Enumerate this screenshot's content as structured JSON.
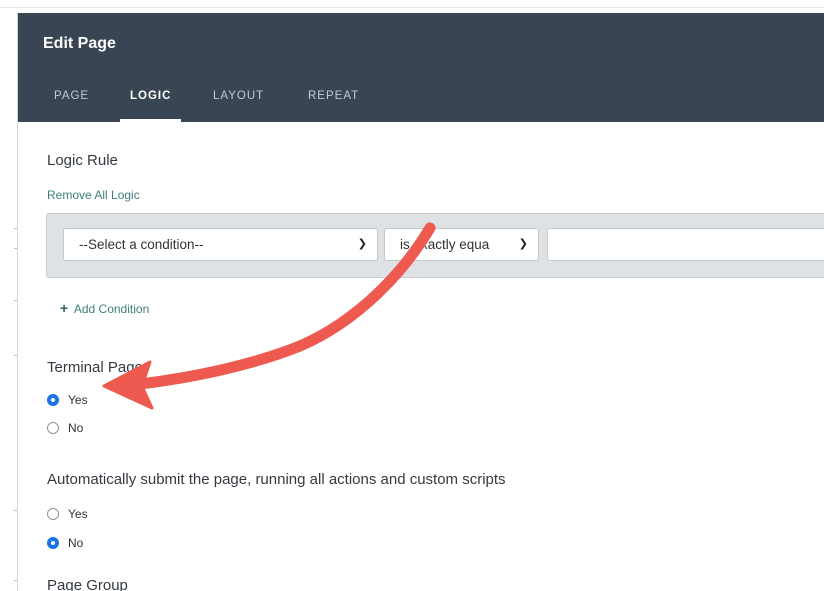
{
  "header": {
    "title": "Edit Page",
    "tabs": [
      {
        "label": "PAGE",
        "active": false
      },
      {
        "label": "LOGIC",
        "active": true
      },
      {
        "label": "LAYOUT",
        "active": false
      },
      {
        "label": "REPEAT",
        "active": false
      }
    ]
  },
  "logic": {
    "title": "Logic Rule",
    "remove_link": "Remove All Logic",
    "condition_select": "--Select a condition--",
    "operator_select": "is exactly equa",
    "value_input": "",
    "add_condition": "Add Condition"
  },
  "terminal": {
    "title": "Terminal Page",
    "options": [
      {
        "label": "Yes",
        "checked": true
      },
      {
        "label": "No",
        "checked": false
      }
    ]
  },
  "autosubmit": {
    "title": "Automatically submit the page, running all actions and custom scripts",
    "options": [
      {
        "label": "Yes",
        "checked": false
      },
      {
        "label": "No",
        "checked": true
      }
    ]
  },
  "page_group": {
    "title": "Page Group"
  },
  "colors": {
    "header_bg": "#3a4553",
    "link": "#3d7f7a",
    "radio_checked": "#1a73e8",
    "annotation_arrow": "#ef5a50"
  },
  "icons": {
    "select_chevron": "chevron-down-icon",
    "add": "plus-icon",
    "annotation": "curved-arrow-icon"
  }
}
